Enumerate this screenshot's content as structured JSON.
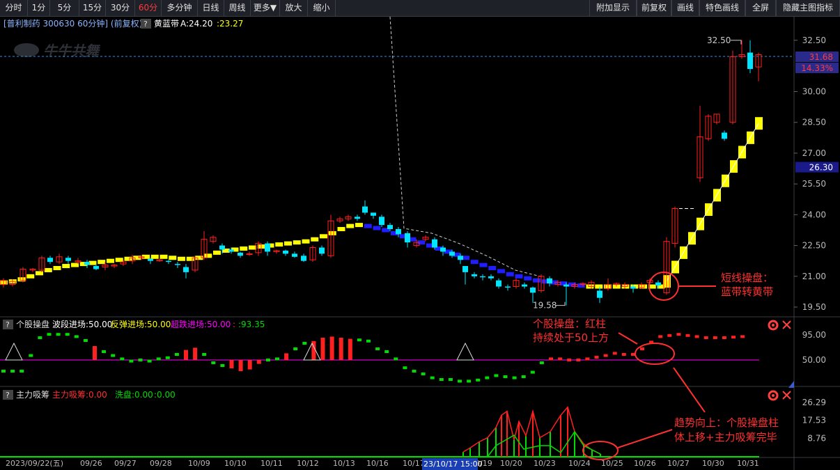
{
  "toolbar": {
    "left": [
      "分时",
      "1分",
      "5分",
      "15分",
      "30分",
      "60分",
      "多分钟",
      "日线",
      "周线",
      "更多▼",
      "放大",
      "缩小"
    ],
    "active": "60分",
    "right": [
      "附加显示",
      "前复权",
      "画线",
      "特色画线",
      "全屏",
      "隐藏主图指标"
    ]
  },
  "main": {
    "stock": "[普利制药 300630 60分钟] (前复权)",
    "help": "?",
    "indicator_name": "黄蓝带",
    "indicator_a": "A:24.20",
    "indicator_b": ":23.27",
    "watermark": "牛牛共舞",
    "price_ticks": [
      "32.50",
      "31.68",
      "30.00",
      "28.50",
      "27.00",
      "26.30",
      "25.50",
      "24.00",
      "22.50",
      "21.00",
      "19.50"
    ],
    "current_price": "31.68",
    "change_pct": "14.33%",
    "high_label": "32.50",
    "low_label": "19.58",
    "note1_line1": "短线操盘：",
    "note1_line2": "蓝带转黄带"
  },
  "sub1": {
    "help": "?",
    "name": "个股操盘",
    "p1": "波段进场:50.00",
    "p2": "反弹进场:50.00",
    "p3": "超跌进场:50.00",
    "p4": ":",
    "p5": ":93.35",
    "ticks": [
      "95.00",
      "50.00"
    ],
    "note_line1": "个股操盘：红柱",
    "note_line2": "持续处于50上方"
  },
  "sub2": {
    "help": "?",
    "name": "主力吸筹",
    "p1": "主力吸筹:0.00",
    "p2": "洗盘:0.00",
    "p3": ":0.00",
    "ticks": [
      "26.29",
      "17.53",
      "8.76"
    ],
    "note_line1": "趋势向上：个股操盘柱",
    "note_line2": "体上移+主力吸筹完毕"
  },
  "xaxis": {
    "labels": [
      "2023/09/22(五)",
      "09/26",
      "09/27",
      "09/28",
      "10/09",
      "10/10",
      "10/11",
      "10/12",
      "10/13",
      "10/16",
      "10/17",
      "10/19",
      "10/20",
      "10/23",
      "10/24",
      "10/25",
      "10/26",
      "10/27",
      "10/30",
      "10/31"
    ],
    "cursor_label": "23/10/17 15:00"
  },
  "colors": {
    "up": "#ff2020",
    "down": "#00e5ff",
    "yellow": "#ffff00",
    "blue": "#1e1eff",
    "magenta": "#ff00ff",
    "green": "#00dd00",
    "annotation": "#ff3030"
  }
}
